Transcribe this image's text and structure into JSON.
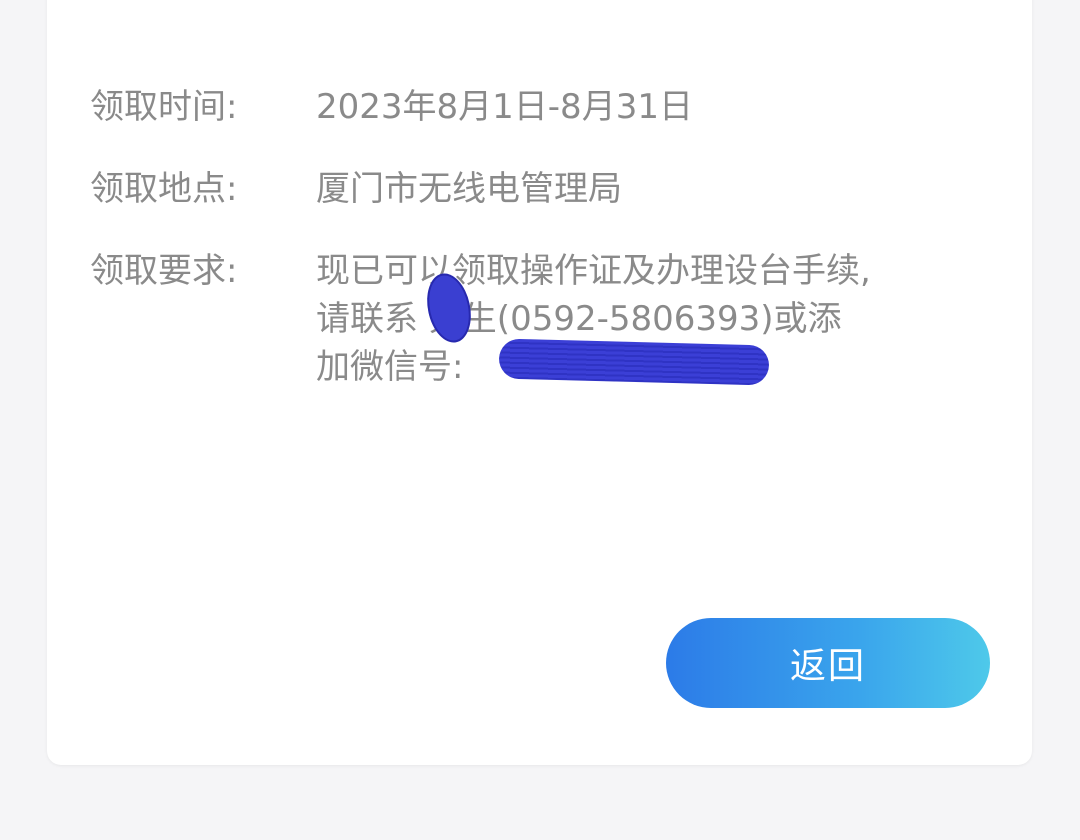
{
  "info": {
    "time": {
      "label": "领取时间:",
      "value": "2023年8月1日-8月31日"
    },
    "location": {
      "label": "领取地点:",
      "value": "厦门市无线电管理局"
    },
    "requirement": {
      "label": "领取要求:",
      "lines": [
        "现已可以领取操作证及办理设台手续,",
        "请联系  先生(0592-5806393)或添",
        "加微信号:"
      ]
    }
  },
  "actions": {
    "back_label": "返回"
  },
  "colors": {
    "label_text": "#8a8a8a",
    "button_gradient_start": "#2c7be8",
    "button_gradient_end": "#4ec9ea",
    "redaction": "#3a3fd1"
  }
}
